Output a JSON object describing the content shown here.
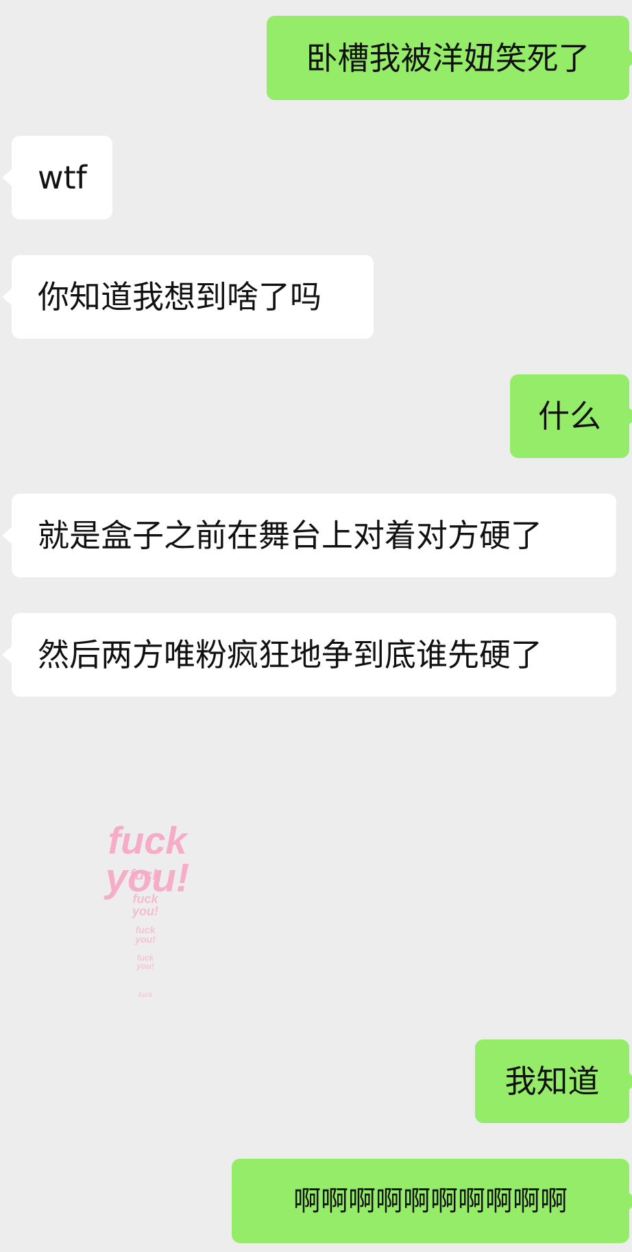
{
  "messages": [
    {
      "side": "sent",
      "text": "卧槽我被洋妞笑死了"
    },
    {
      "side": "recv",
      "text": "wtf"
    },
    {
      "side": "recv",
      "text": "你知道我想到啥了吗"
    },
    {
      "side": "sent",
      "text": "什么"
    },
    {
      "side": "recv",
      "text": "就是盒子之前在舞台上对着对方硬了"
    },
    {
      "side": "recv",
      "text": "然后两方唯粉疯狂地争到底谁先硬了"
    },
    {
      "side": "recv",
      "type": "sticker",
      "sticker": {
        "line1": "fuck",
        "line2": "you!"
      }
    },
    {
      "side": "sent",
      "text": "我知道"
    },
    {
      "side": "sent",
      "text": "啊啊啊啊啊啊啊啊啊啊"
    }
  ],
  "colors": {
    "background": "#ededed",
    "sent_bubble": "#95ec69",
    "recv_bubble": "#ffffff",
    "sticker_pink": "#f7a8c4"
  }
}
